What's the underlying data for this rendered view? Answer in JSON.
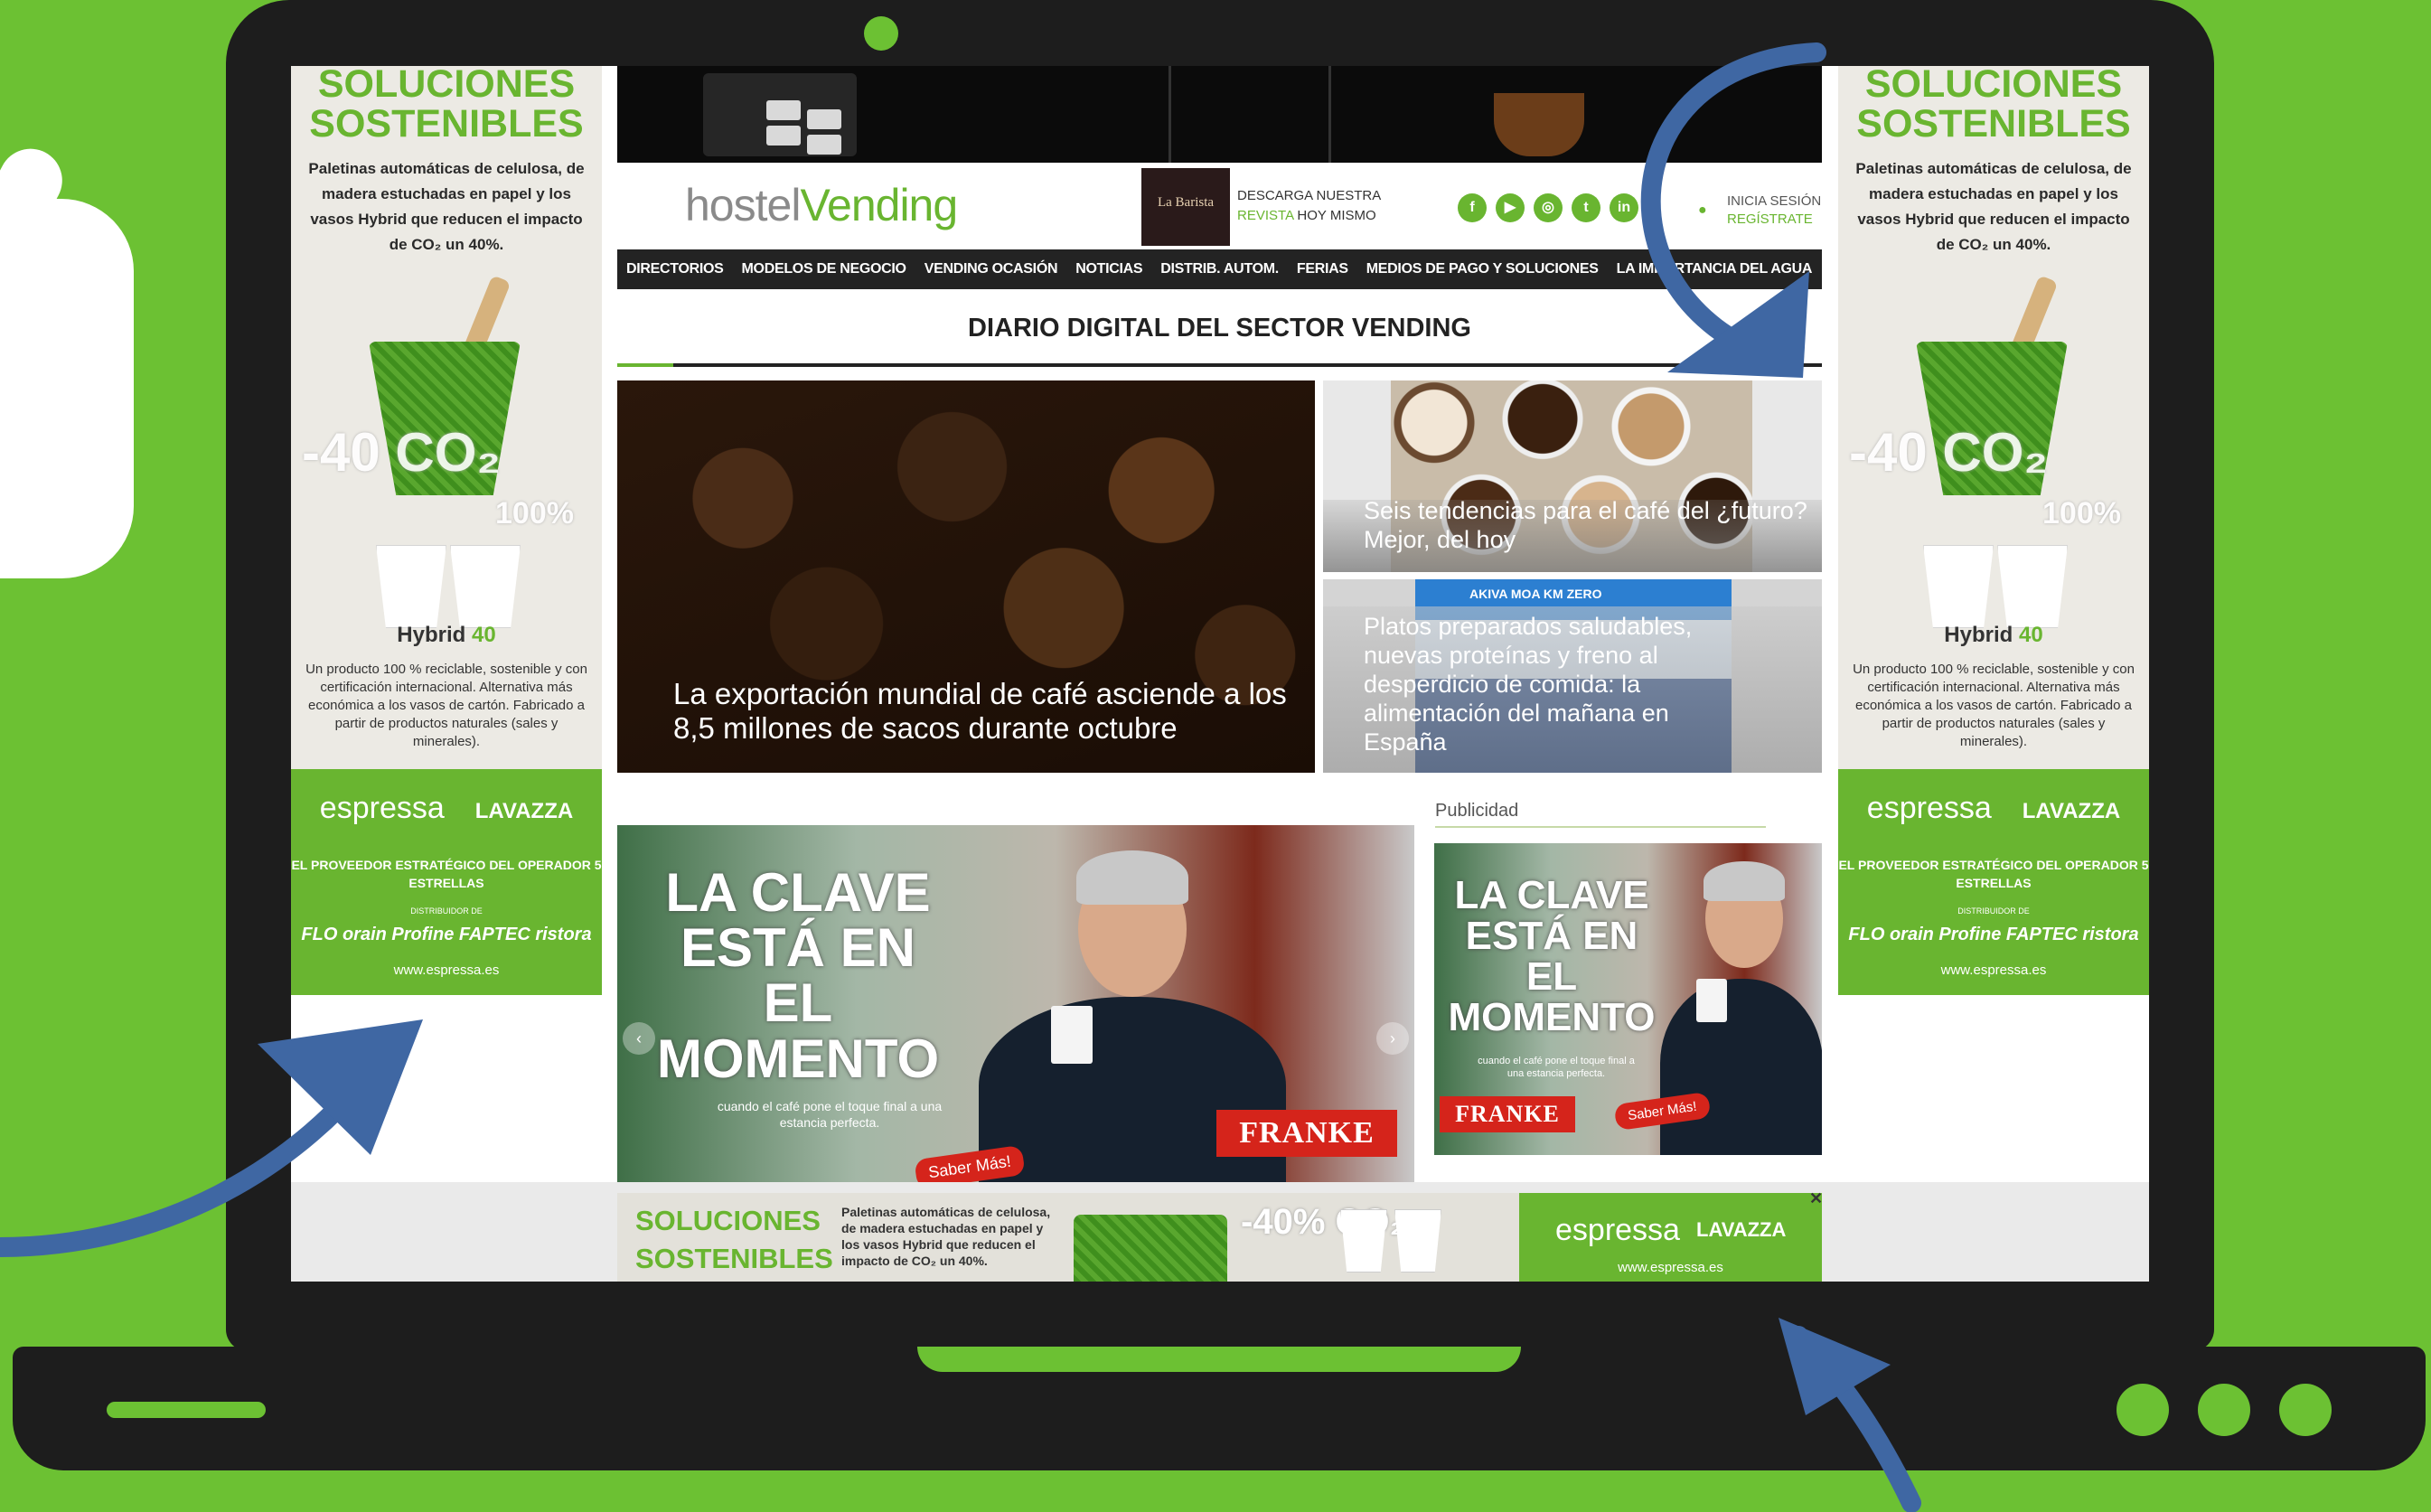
{
  "side_ad": {
    "headline_1": "SOLUCIONES",
    "headline_2": "SOSTENIBLES",
    "copy": "Paletinas automáticas de celulosa, de madera estuchadas en papel y los vasos Hybrid que reducen el impacto de CO₂ un 40%.",
    "co2": "-40 CO₂",
    "percent": "100%",
    "product_prefix": "Hybrid",
    "product_suffix": "40",
    "small_print": "Un producto 100 % reciclable, sostenible y con certificación internacional. Alternativa más económica a los vasos de cartón. Fabricado a partir de productos naturales (sales y minerales).",
    "brand_1": "espressa",
    "brand_2": "LAVAZZA",
    "provider": "EL PROVEEDOR ESTRATÉGICO DEL OPERADOR 5 ESTRELLAS",
    "distribuidor": "DISTRIBUIDOR DE",
    "partner_logos": "FLO  orain  Profine  FAPTEC  ristora",
    "website": "www.espressa.es"
  },
  "header": {
    "logo_part_1": "hostel",
    "logo_part_2": "Vending",
    "magazine_cover": "La Barista",
    "download_line_1": "DESCARGA NUESTRA",
    "download_line_2a": "REVISTA",
    "download_line_2b": "HOY MISMO",
    "login": "INICIA SESIÓN",
    "register": "REGÍSTRATE"
  },
  "social": [
    {
      "name": "facebook-icon",
      "glyph": "f"
    },
    {
      "name": "youtube-icon",
      "glyph": "▶"
    },
    {
      "name": "instagram-icon",
      "glyph": "◎"
    },
    {
      "name": "twitter-icon",
      "glyph": "t"
    },
    {
      "name": "linkedin-icon",
      "glyph": "in"
    }
  ],
  "nav": [
    "DIRECTORIOS",
    "MODELOS DE NEGOCIO",
    "VENDING OCASIÓN",
    "NOTICIAS",
    "DISTRIB. AUTOM.",
    "FERIAS",
    "MEDIOS DE PAGO Y SOLUCIONES",
    "LA IMPORTANCIA DEL AGUA"
  ],
  "section_title": "DIARIO DIGITAL DEL SECTOR VENDING",
  "stories": {
    "main": "La exportación mundial de café asciende a los 8,5 millones de sacos durante octubre",
    "side_1": "Seis tendencias para el café del ¿futuro? Mejor, del hoy",
    "side_2": "Platos preparados saludables, nuevas proteínas y freno al desperdicio de comida: la alimentación del mañana en España",
    "side_2_logos": "AKIVA  MOA  KM ZERO"
  },
  "advertising": {
    "label": "Publicidad",
    "headline": "LA CLAVE ESTÁ EN EL MOMENTO",
    "tagline": "cuando el café pone el toque final a una estancia perfecta.",
    "brand": "FRANKE",
    "cta_large": "Saber Más!",
    "cta_small": "Saber Más!"
  },
  "sticky_ad": {
    "headline_1": "SOLUCIONES",
    "headline_2": "SOSTENIBLES",
    "copy": "Paletinas automáticas de celulosa, de madera estuchadas en papel y los vasos Hybrid que reducen el impacto de CO₂ un 40%.",
    "co2": "-40% CO₂",
    "brand_1": "espressa",
    "brand_2": "LAVAZZA",
    "website": "www.espressa.es",
    "close": "✕"
  },
  "colors": {
    "background": "#6cc133",
    "laptop": "#1d1d1d",
    "brand_green": "#69b530",
    "arrow_blue": "#3f67a3"
  }
}
